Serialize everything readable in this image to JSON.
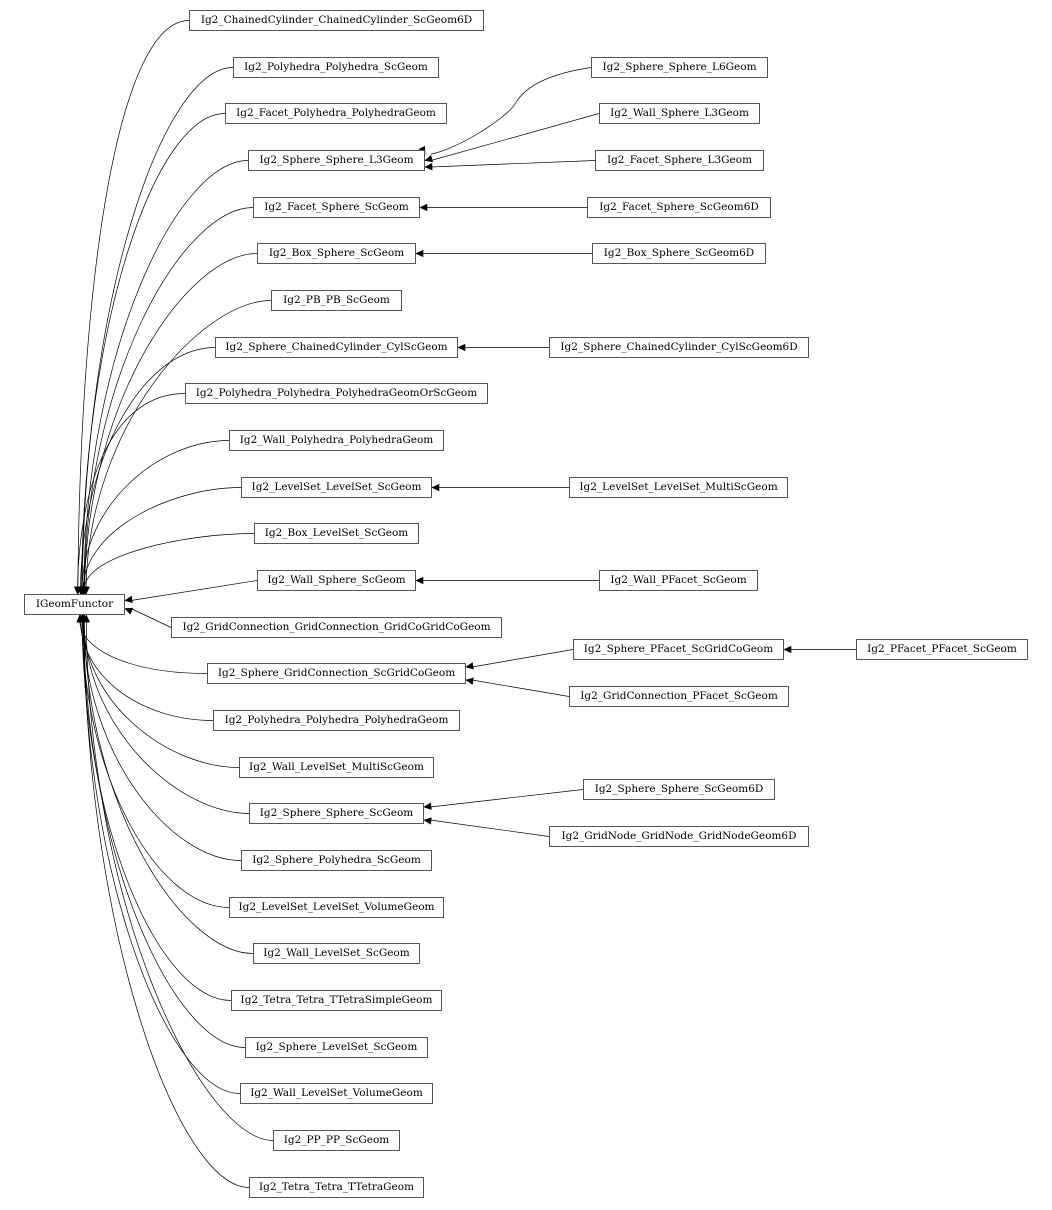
{
  "diagram": {
    "type": "inheritance-graph",
    "root": {
      "id": "root",
      "label": "IGeomFunctor"
    },
    "nodes": [
      {
        "id": "n1",
        "label": "Ig2_ChainedCylinder_ChainedCylinder_ScGeom6D"
      },
      {
        "id": "n2",
        "label": "Ig2_Polyhedra_Polyhedra_ScGeom"
      },
      {
        "id": "n3",
        "label": "Ig2_Facet_Polyhedra_PolyhedraGeom"
      },
      {
        "id": "n4",
        "label": "Ig2_Sphere_Sphere_L3Geom"
      },
      {
        "id": "n5",
        "label": "Ig2_Facet_Sphere_ScGeom"
      },
      {
        "id": "n6",
        "label": "Ig2_Box_Sphere_ScGeom"
      },
      {
        "id": "n7",
        "label": "Ig2_PB_PB_ScGeom"
      },
      {
        "id": "n8",
        "label": "Ig2_Sphere_ChainedCylinder_CylScGeom"
      },
      {
        "id": "n9",
        "label": "Ig2_Polyhedra_Polyhedra_PolyhedraGeomOrScGeom"
      },
      {
        "id": "n10",
        "label": "Ig2_Wall_Polyhedra_PolyhedraGeom"
      },
      {
        "id": "n11",
        "label": "Ig2_LevelSet_LevelSet_ScGeom"
      },
      {
        "id": "n12",
        "label": "Ig2_Box_LevelSet_ScGeom"
      },
      {
        "id": "n13",
        "label": "Ig2_Wall_Sphere_ScGeom"
      },
      {
        "id": "n14",
        "label": "Ig2_GridConnection_GridConnection_GridCoGridCoGeom"
      },
      {
        "id": "n15",
        "label": "Ig2_Sphere_GridConnection_ScGridCoGeom"
      },
      {
        "id": "n16",
        "label": "Ig2_Polyhedra_Polyhedra_PolyhedraGeom"
      },
      {
        "id": "n17",
        "label": "Ig2_Wall_LevelSet_MultiScGeom"
      },
      {
        "id": "n18",
        "label": "Ig2_Sphere_Sphere_ScGeom"
      },
      {
        "id": "n19",
        "label": "Ig2_Sphere_Polyhedra_ScGeom"
      },
      {
        "id": "n20",
        "label": "Ig2_LevelSet_LevelSet_VolumeGeom"
      },
      {
        "id": "n21",
        "label": "Ig2_Wall_LevelSet_ScGeom"
      },
      {
        "id": "n22",
        "label": "Ig2_Tetra_Tetra_TTetraSimpleGeom"
      },
      {
        "id": "n23",
        "label": "Ig2_Sphere_LevelSet_ScGeom"
      },
      {
        "id": "n24",
        "label": "Ig2_Wall_LevelSet_VolumeGeom"
      },
      {
        "id": "n25",
        "label": "Ig2_PP_PP_ScGeom"
      },
      {
        "id": "n26",
        "label": "Ig2_Tetra_Tetra_TTetraGeom"
      },
      {
        "id": "m1",
        "label": "Ig2_Sphere_Sphere_L6Geom"
      },
      {
        "id": "m2",
        "label": "Ig2_Wall_Sphere_L3Geom"
      },
      {
        "id": "m3",
        "label": "Ig2_Facet_Sphere_L3Geom"
      },
      {
        "id": "m4",
        "label": "Ig2_Facet_Sphere_ScGeom6D"
      },
      {
        "id": "m5",
        "label": "Ig2_Box_Sphere_ScGeom6D"
      },
      {
        "id": "m6",
        "label": "Ig2_Sphere_ChainedCylinder_CylScGeom6D"
      },
      {
        "id": "m7",
        "label": "Ig2_LevelSet_LevelSet_MultiScGeom"
      },
      {
        "id": "m8",
        "label": "Ig2_Wall_PFacet_ScGeom"
      },
      {
        "id": "m9",
        "label": "Ig2_Sphere_PFacet_ScGridCoGeom"
      },
      {
        "id": "m10",
        "label": "Ig2_GridConnection_PFacet_ScGeom"
      },
      {
        "id": "m11",
        "label": "Ig2_Sphere_Sphere_ScGeom6D"
      },
      {
        "id": "m12",
        "label": "Ig2_GridNode_GridNode_GridNodeGeom6D"
      },
      {
        "id": "p1",
        "label": "Ig2_PFacet_PFacet_ScGeom"
      }
    ],
    "edges": [
      [
        "n1",
        "root"
      ],
      [
        "n2",
        "root"
      ],
      [
        "n3",
        "root"
      ],
      [
        "n4",
        "root"
      ],
      [
        "n5",
        "root"
      ],
      [
        "n6",
        "root"
      ],
      [
        "n7",
        "root"
      ],
      [
        "n8",
        "root"
      ],
      [
        "n9",
        "root"
      ],
      [
        "n10",
        "root"
      ],
      [
        "n11",
        "root"
      ],
      [
        "n12",
        "root"
      ],
      [
        "n13",
        "root"
      ],
      [
        "n14",
        "root"
      ],
      [
        "n15",
        "root"
      ],
      [
        "n16",
        "root"
      ],
      [
        "n17",
        "root"
      ],
      [
        "n18",
        "root"
      ],
      [
        "n19",
        "root"
      ],
      [
        "n20",
        "root"
      ],
      [
        "n21",
        "root"
      ],
      [
        "n22",
        "root"
      ],
      [
        "n23",
        "root"
      ],
      [
        "n24",
        "root"
      ],
      [
        "n25",
        "root"
      ],
      [
        "n26",
        "root"
      ],
      [
        "m1",
        "n4"
      ],
      [
        "m2",
        "n4"
      ],
      [
        "m3",
        "n4"
      ],
      [
        "m4",
        "n5"
      ],
      [
        "m5",
        "n6"
      ],
      [
        "m6",
        "n8"
      ],
      [
        "m7",
        "n11"
      ],
      [
        "m8",
        "n13"
      ],
      [
        "m9",
        "n15"
      ],
      [
        "m10",
        "n15"
      ],
      [
        "m11",
        "n18"
      ],
      [
        "m12",
        "n18"
      ],
      [
        "p1",
        "m9"
      ]
    ]
  }
}
